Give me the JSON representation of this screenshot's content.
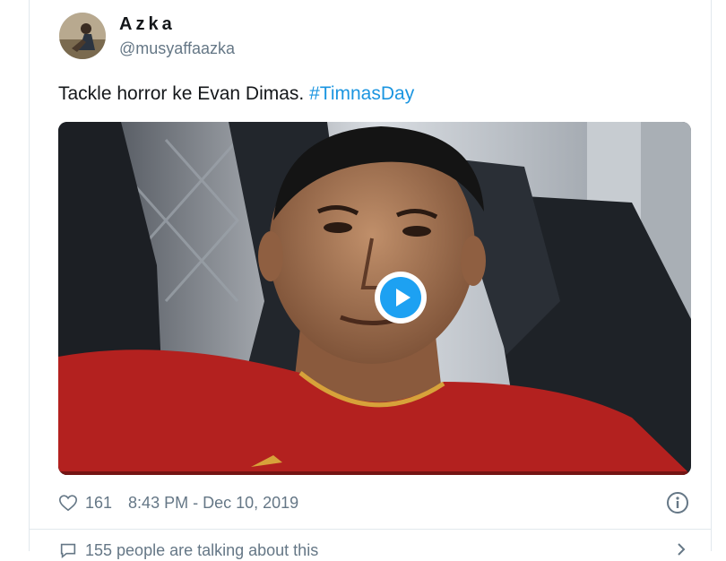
{
  "tweet": {
    "display_name": "Azka",
    "handle": "@musyaffaazka",
    "text": "Tackle horror ke Evan Dimas. ",
    "hashtag": "#TimnasDay",
    "likes": "161",
    "timestamp": "8:43 PM - Dec 10, 2019",
    "replies_text": "155 people are talking about this"
  },
  "media": {
    "type": "video",
    "play_icon": "play-icon"
  },
  "icons": {
    "like": "heart-outline-icon",
    "info": "info-circle-icon",
    "reply": "speech-bubble-icon",
    "more": "chevron-right-icon"
  },
  "colors": {
    "link": "#1b95e0",
    "play_button": "#1da1f2",
    "secondary_text": "#657786",
    "jersey": "#b3211f"
  }
}
